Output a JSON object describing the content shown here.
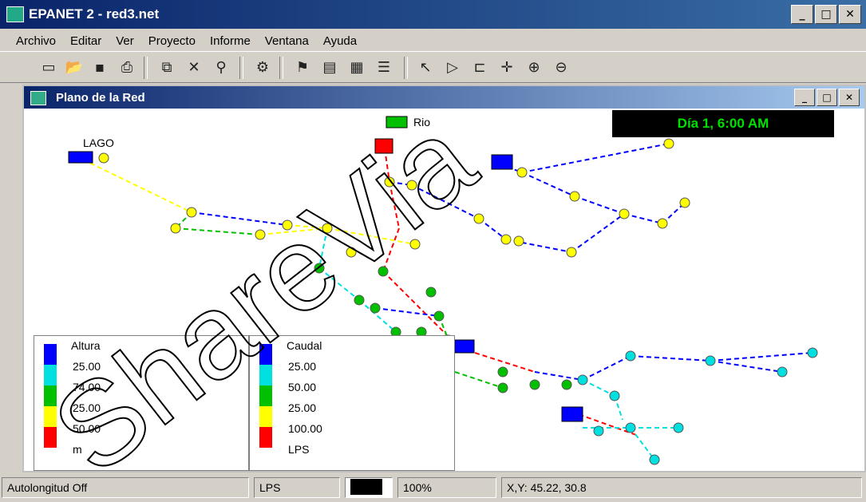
{
  "window": {
    "title": "EPANET 2 - red3.net",
    "controls": [
      "_",
      "□",
      "✕"
    ]
  },
  "menu": [
    "Archivo",
    "Editar",
    "Ver",
    "Proyecto",
    "Informe",
    "Ventana",
    "Ayuda"
  ],
  "map_window": {
    "title": "Plano de la Red",
    "time": "Día 1, 6:00 AM",
    "labels": {
      "lake": "LAGO",
      "river": "Rio"
    }
  },
  "legend_nodes": {
    "title": "Altura",
    "values": [
      "25.00",
      "74.00",
      "25.00",
      "50.00",
      "m"
    ]
  },
  "legend_links": {
    "title": "Caudal",
    "values": [
      "25.00",
      "50.00",
      "25.00",
      "100.00",
      "LPS"
    ]
  },
  "colors": {
    "blue": "#0000ff",
    "cyan": "#00e0e0",
    "green": "#00c000",
    "yellow": "#ffff00",
    "red": "#ff0000"
  },
  "status": {
    "autolength": "Autolongitud Off",
    "units": "LPS",
    "zoom": "100%",
    "coords": "X,Y: 45.22, 30.8"
  },
  "watermark": "ShareVia"
}
